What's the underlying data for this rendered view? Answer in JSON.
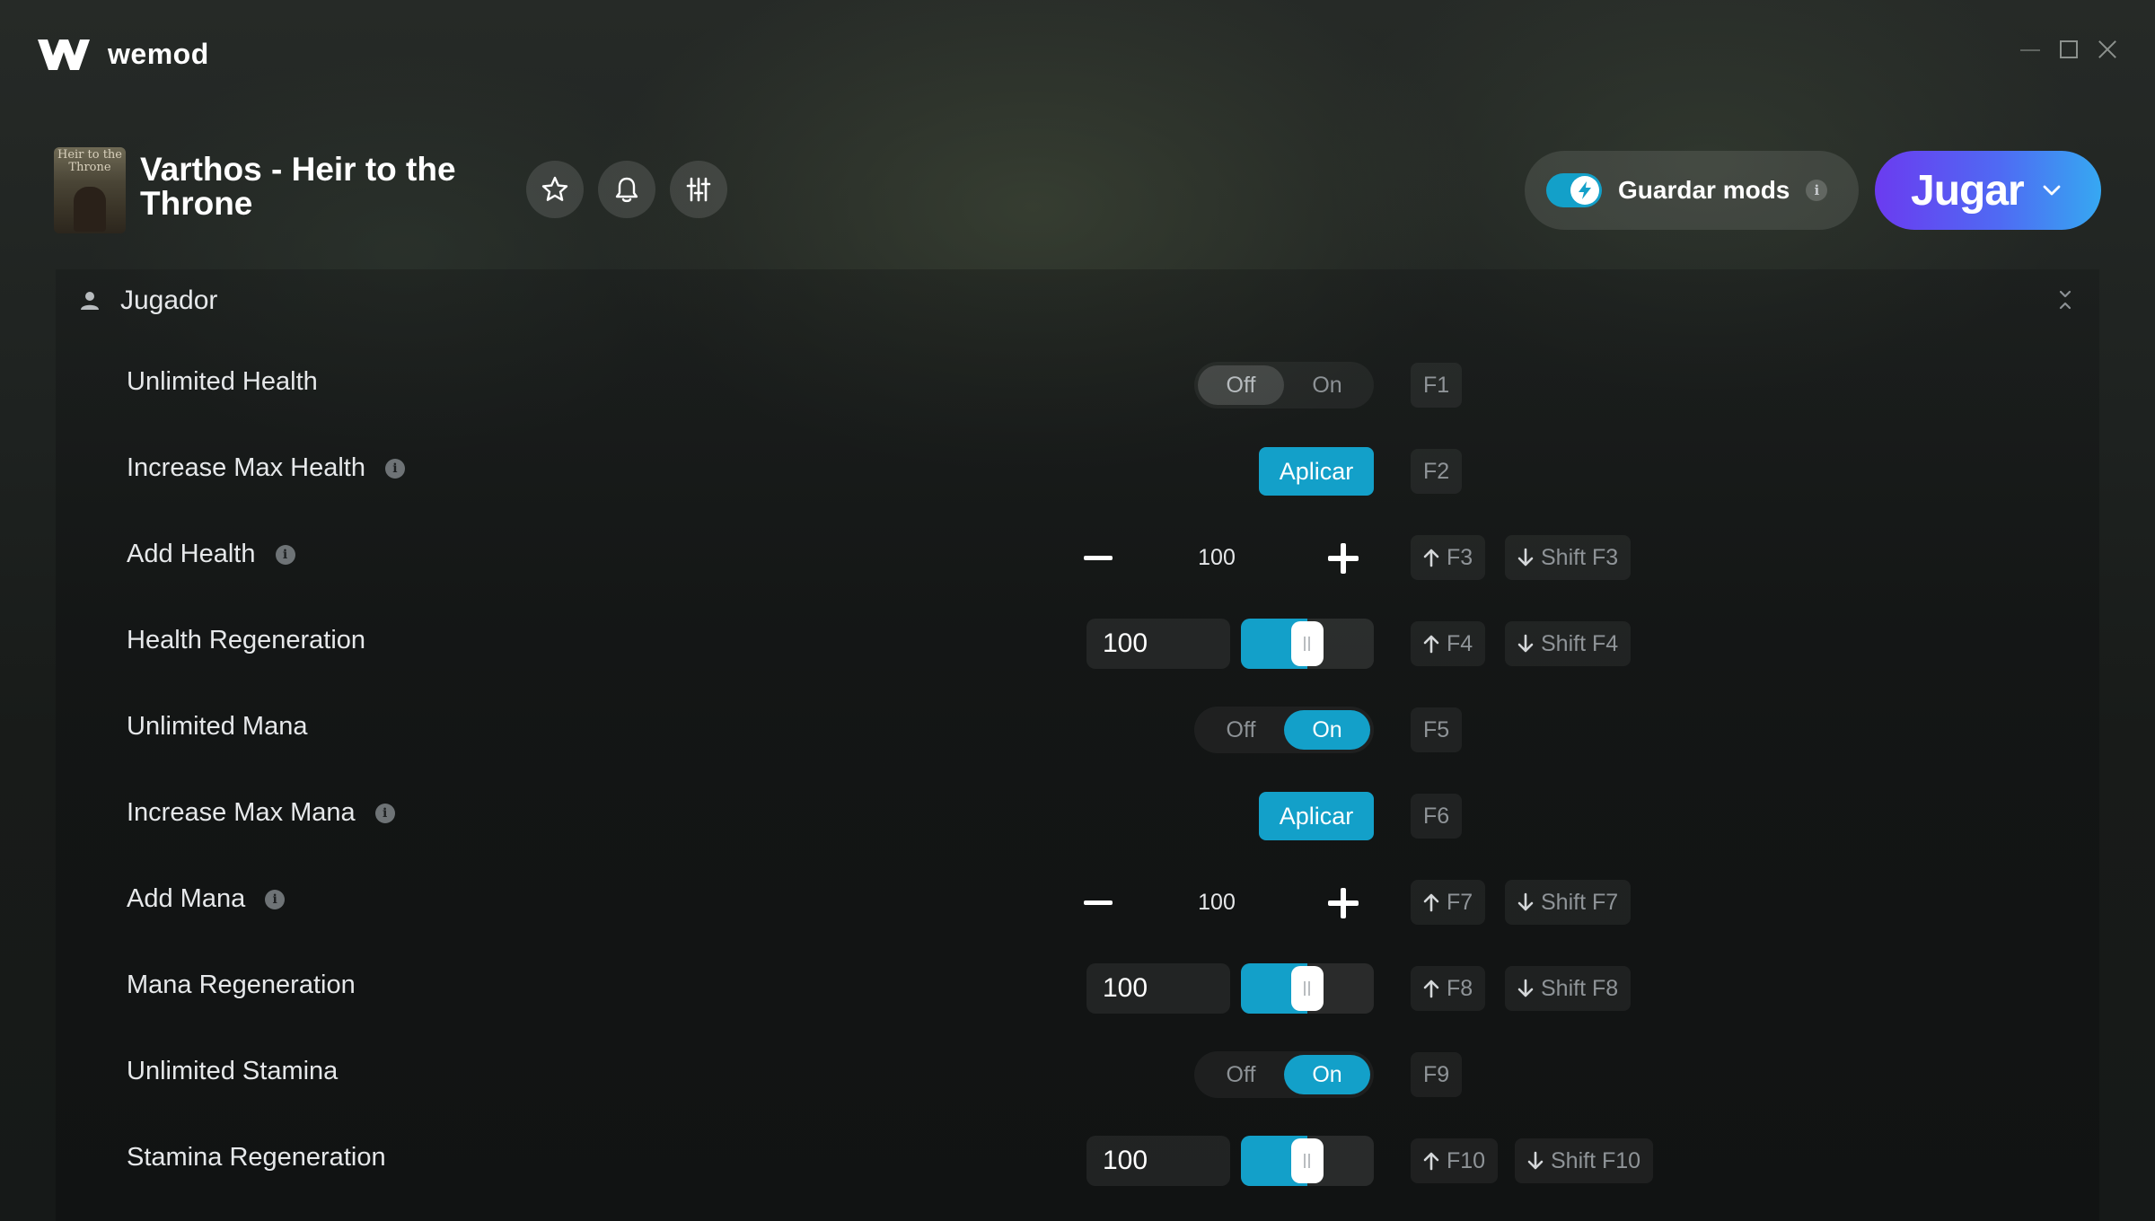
{
  "app": {
    "name": "wemod"
  },
  "game": {
    "title": "Varthos - Heir to the Throne",
    "thumb_text": "Heir to the Throne"
  },
  "header": {
    "save_mods_label": "Guardar mods",
    "save_mods_enabled": true,
    "info_glyph": "i",
    "play_label": "Jugar"
  },
  "category": {
    "label": "Jugador"
  },
  "mods": [
    {
      "label": "Unlimited Health",
      "type": "toggle",
      "off": "Off",
      "on": "On",
      "state": "off",
      "keys": [
        "F1"
      ]
    },
    {
      "label": "Increase Max Health",
      "info": true,
      "type": "button",
      "button": "Aplicar",
      "keys": [
        "F2"
      ]
    },
    {
      "label": "Add Health",
      "info": true,
      "type": "stepper",
      "value": "100",
      "keys": [
        "F3",
        "Shift F3"
      ]
    },
    {
      "label": "Health Regeneration",
      "type": "slider",
      "value": "100",
      "fraction": 0.5,
      "keys": [
        "F4",
        "Shift F4"
      ]
    },
    {
      "label": "Unlimited Mana",
      "type": "toggle",
      "off": "Off",
      "on": "On",
      "state": "on",
      "keys": [
        "F5"
      ]
    },
    {
      "label": "Increase Max Mana",
      "info": true,
      "type": "button",
      "button": "Aplicar",
      "keys": [
        "F6"
      ]
    },
    {
      "label": "Add Mana",
      "info": true,
      "type": "stepper",
      "value": "100",
      "keys": [
        "F7",
        "Shift F7"
      ]
    },
    {
      "label": "Mana Regeneration",
      "type": "slider",
      "value": "100",
      "fraction": 0.5,
      "keys": [
        "F8",
        "Shift F8"
      ]
    },
    {
      "label": "Unlimited Stamina",
      "type": "toggle",
      "off": "Off",
      "on": "On",
      "state": "on",
      "keys": [
        "F9"
      ]
    },
    {
      "label": "Stamina Regeneration",
      "type": "slider",
      "value": "100",
      "fraction": 0.5,
      "keys": [
        "F10",
        "Shift F10"
      ]
    }
  ],
  "colors": {
    "accent": "#13a0c9",
    "play_gradient_start": "#6b3bf0",
    "play_gradient_end": "#36a8f2"
  },
  "icons": {
    "logo": "wemod-logo-icon",
    "favorite": "star-icon",
    "notifications": "bell-icon",
    "settings": "sliders-icon",
    "save_mods": "lightning-icon",
    "category": "user-icon",
    "collapse": "chevron-collapse-icon",
    "increase": "arrow-up-icon",
    "decrease": "arrow-down-icon"
  }
}
